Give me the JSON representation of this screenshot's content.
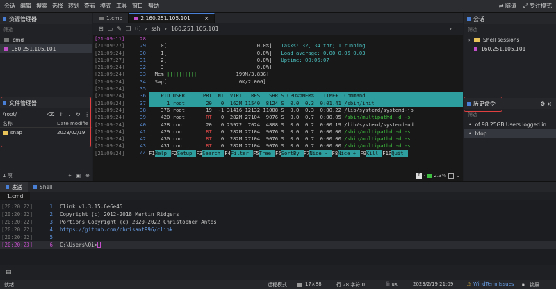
{
  "menu": [
    "会话",
    "编辑",
    "搜索",
    "选择",
    "转到",
    "查看",
    "模式",
    "工具",
    "窗口",
    "帮助"
  ],
  "menu_right": {
    "tunnel": "隧道",
    "focus": "专注模式"
  },
  "left_panel": {
    "title": "资源管理器",
    "filter": "筛选",
    "items": [
      {
        "label": "cmd"
      },
      {
        "label": "160.251.105.101"
      }
    ]
  },
  "file_manager": {
    "title": "文件管理器",
    "path": "/root/",
    "col_name": "名称",
    "col_date": "Date modifie",
    "files": [
      {
        "name": "snap",
        "date": "2023/02/19"
      }
    ],
    "count": "1 项"
  },
  "tabs": [
    {
      "label": "1.cmd"
    },
    {
      "label": "2.160.251.105.101"
    }
  ],
  "toolbar": {
    "proto": "ssh",
    "host": "160.251.105.101"
  },
  "terminal": {
    "lines": [
      {
        "ts": "[21:09:11]",
        "n": "28",
        "text": "",
        "cur": true
      },
      {
        "ts": "[21:09:27]",
        "n": "29",
        "text": "    0[                              0.0%]   Tasks: 32, 34 thr; 1 running"
      },
      {
        "ts": "[21:09:24]",
        "n": "30",
        "text": "    1[                              0.0%]   Load average: 0.00 0.05 0.03"
      },
      {
        "ts": "[21:07:27]",
        "n": "31",
        "text": "    2[                              0.0%]   Uptime: 00:06:07"
      },
      {
        "ts": "[21:09:24]",
        "n": "32",
        "text": "    3[                              0.0%]"
      },
      {
        "ts": "[21:09:24]",
        "n": "33",
        "text": "  Mem[||||||||||             199M/3.83G]"
      },
      {
        "ts": "[21:09:24]",
        "n": "34",
        "text": "  Swp[                        0K/2.00G]"
      },
      {
        "ts": "[21:09:24]",
        "n": "35",
        "text": ""
      },
      {
        "ts": "[21:09:24]",
        "n": "36",
        "text": "    PID USER      PRI  NI  VIRT   RES   SHR S CPU%▽MEM%   TIME+  Command",
        "hdr": true
      },
      {
        "ts": "[21:09:24]",
        "n": "37",
        "text": "      1 root       20   0  162M 11540  8124 S  0.0  0.3  0:01.41 /sbin/init",
        "sel": true
      },
      {
        "ts": "[21:09:24]",
        "n": "38",
        "text": "    376 root       19  -1 31416 12132 11008 S  0.0  0.3  0:00.22 /lib/systemd/systemd-jo"
      },
      {
        "ts": "[21:09:24]",
        "n": "39",
        "text": "    420 root       RT   0  282M 27104  9076 S  0.0  0.7  0:00.05 /sbin/multipathd -d -s"
      },
      {
        "ts": "[21:09:24]",
        "n": "40",
        "text": "    428 root       20   0 25972  7024  4808 S  0.0  0.2  0:00.19 /lib/systemd/systemd-ud"
      },
      {
        "ts": "[21:09:24]",
        "n": "41",
        "text": "    429 root       RT   0  282M 27104  9076 S  0.0  0.7  0:00.00 /sbin/multipathd -d -s"
      },
      {
        "ts": "[21:09:24]",
        "n": "42",
        "text": "    430 root       RT   0  282M 27104  9076 S  0.0  0.7  0:00.00 /sbin/multipathd -d -s"
      },
      {
        "ts": "[21:09:24]",
        "n": "43",
        "text": "    431 root       RT   0  282M 27104  9076 S  0.0  0.7  0:00.00 /sbin/multipathd -d -s"
      }
    ],
    "keys_ts": "[21:09:24]",
    "keys_n": "44",
    "keys": [
      [
        "F1",
        "Help"
      ],
      [
        "F2",
        "Setup"
      ],
      [
        "F3",
        "Search"
      ],
      [
        "F4",
        "Filter"
      ],
      [
        "F5",
        "Tree"
      ],
      [
        "F6",
        "SortBy"
      ],
      [
        "F7",
        "Nice -"
      ],
      [
        "F8",
        "Nice +"
      ],
      [
        "F9",
        "Kill"
      ],
      [
        "F10",
        "Quit"
      ]
    ],
    "cpu_usage": "2.3%"
  },
  "right_panel": {
    "title": "会话",
    "filter": "筛选",
    "group": "Shell sessions",
    "items": [
      {
        "label": "160.251.105.101"
      }
    ]
  },
  "history": {
    "title": "历史命令",
    "filter": "筛选",
    "items": [
      "of 98.25GB Users logged in",
      "htop"
    ]
  },
  "bottom": {
    "tabs": [
      "发送",
      "Shell"
    ],
    "subtab": "1.cmd",
    "lines": [
      {
        "ts": "[20:20:22]",
        "n": "1",
        "text": "Clink v1.3.15.6e6e45"
      },
      {
        "ts": "[20:20:22]",
        "n": "2",
        "text": "Copyright (c) 2012-2018 Martin Ridgers"
      },
      {
        "ts": "[20:20:22]",
        "n": "3",
        "text": "Portions Copyright (c) 2020-2022 Christopher Antos"
      },
      {
        "ts": "[20:20:22]",
        "n": "4",
        "text": "https://github.com/chrisant996/clink",
        "link": true
      },
      {
        "ts": "[20:20:22]",
        "n": "5",
        "text": ""
      },
      {
        "ts": "[20:20:23]",
        "n": "6",
        "text": "C:\\Users\\Qi>",
        "cur": true
      }
    ]
  },
  "status": {
    "left": "就绪",
    "mode": "远程模式",
    "size": "17×88",
    "pos": "行 28 字符 0",
    "os": "linux",
    "datetime": "2023/2/19 21:09",
    "issues": "WindTerm Issues",
    "lock": "锁屏"
  }
}
